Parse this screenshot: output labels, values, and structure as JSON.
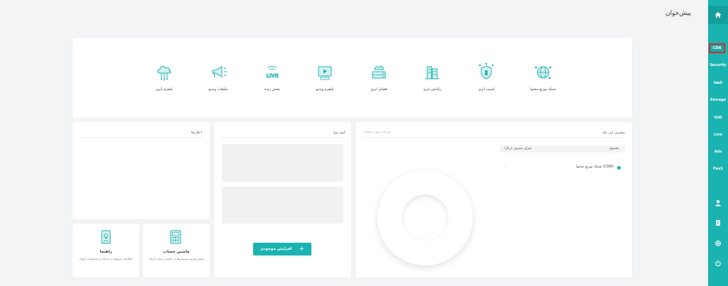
{
  "page": {
    "title": "پیش‌خوان"
  },
  "sidebar": {
    "items": [
      {
        "label": "CDN",
        "active": true
      },
      {
        "label": "Security"
      },
      {
        "label": "IaaS"
      },
      {
        "label": "Storage"
      },
      {
        "label": "VoD"
      },
      {
        "label": "Live"
      },
      {
        "label": "Ads"
      },
      {
        "label": "PaaS"
      }
    ],
    "bottom_icons": [
      "user-icon",
      "document-icon",
      "settings-gear-icon",
      "power-icon"
    ]
  },
  "services": [
    {
      "label": "شبکه توزیع محتوا",
      "icon": "cdn-globe-icon"
    },
    {
      "label": "امنیت ابری",
      "icon": "cloud-security-icon"
    },
    {
      "label": "رایانش ابری",
      "icon": "cloud-computing-icon"
    },
    {
      "label": "فضای ابری",
      "icon": "cloud-storage-icon"
    },
    {
      "label": "پلتفرم ویدیو",
      "icon": "video-platform-icon"
    },
    {
      "label": "پخش زنده",
      "icon": "live-icon"
    },
    {
      "label": "تبلیغات ویدیو",
      "icon": "megaphone-icon"
    },
    {
      "label": "پلتفرم ابری",
      "icon": "cloud-platform-icon"
    }
  ],
  "usage": {
    "title": "مصرف این ماه",
    "subtitle": "جزییات صورت‌حساب",
    "columns": {
      "product": "محصول",
      "amount": "میزان مصرف (ریال)"
    },
    "rows": [
      {
        "product": "شبکه توزیع محتوا (CDN)",
        "amount": "۰"
      }
    ]
  },
  "wallet": {
    "title": "کیف پول",
    "button": "افزایش موجودی"
  },
  "announcements": {
    "title": "اعلان‌ها"
  },
  "calculator": {
    "title": "ماشین حساب",
    "subtitle": "تخمین هزینه سرویس‌ها در ماشین حساب آروان"
  },
  "guide": {
    "title": "راهنما",
    "subtitle": "اطلاعات مربوط به خدمات و محصولات آروان"
  }
}
